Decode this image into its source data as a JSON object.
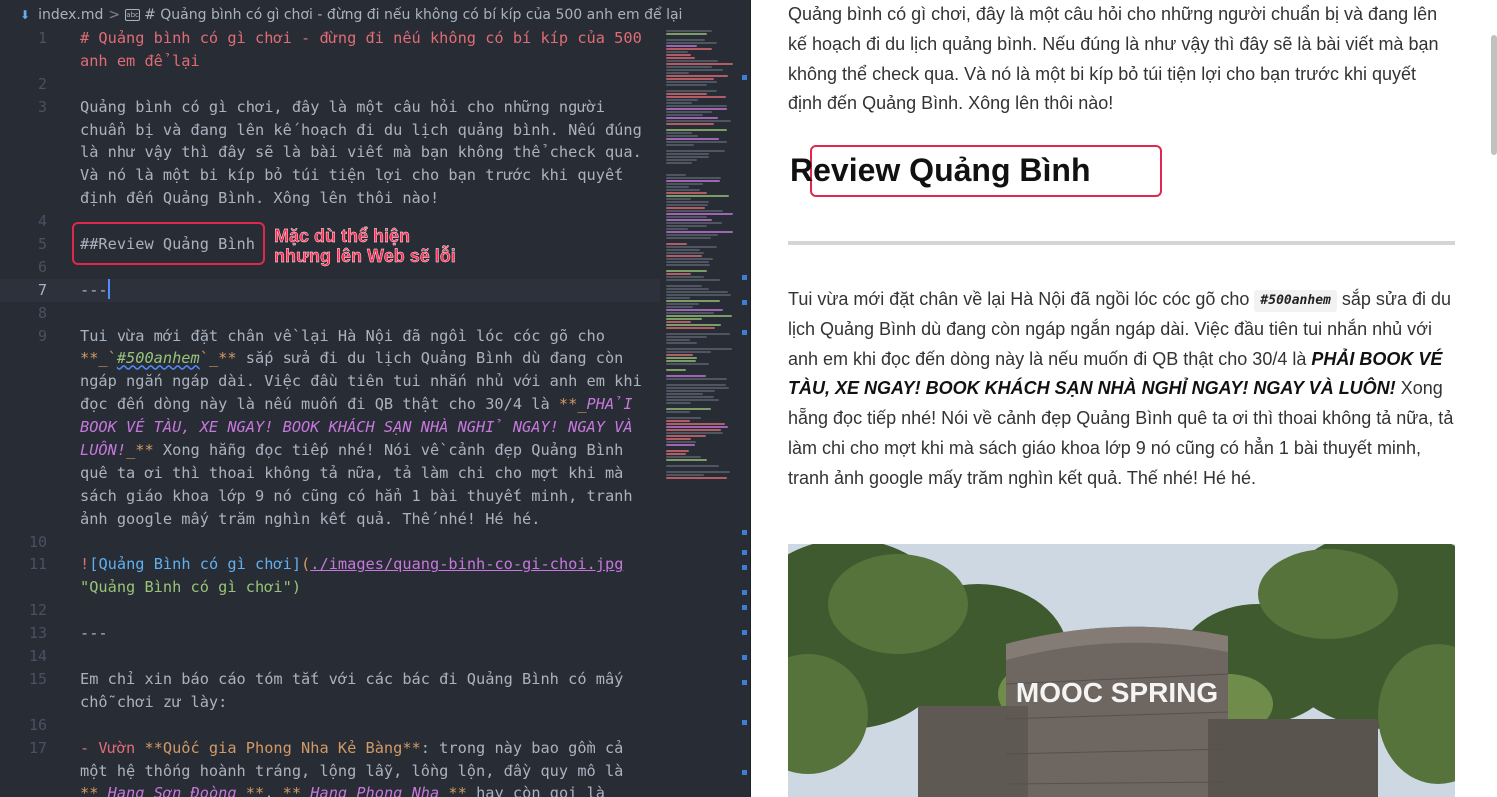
{
  "breadcrumb": {
    "file": "index.md",
    "separator": ">",
    "symbol": "# Quảng bình có gì chơi - đừng đi nếu không có bí kíp của 500 anh em để lại"
  },
  "editor": {
    "line_numbers": [
      "1",
      "",
      "2",
      "3",
      "",
      "",
      "",
      "",
      "4",
      "5",
      "6",
      "7",
      "8",
      "9",
      "",
      "",
      "",
      "",
      "",
      "",
      "",
      "",
      "10",
      "11",
      "",
      "12",
      "13",
      "14",
      "15",
      "",
      "16",
      "17",
      "",
      ""
    ],
    "line1_a": "# Quảng bình có gì chơi - đừng đi nếu không có bí kíp của 500",
    "line1_b": "anh em để lại",
    "line3": [
      "Quảng bình có gì chơi, đây là một câu hỏi cho những người",
      "chuẩn bị và đang lên kế hoạch đi du lịch quảng bình. Nếu đúng",
      "là như vậy thì đây sẽ là bài viết mà bạn không thể check qua.",
      "Và nó là một bi kíp bỏ túi tiện lợi cho bạn trước khi quyết",
      "định đến Quảng Bình. Xông lên thôi nào!"
    ],
    "line5": "##Review Quảng Bình",
    "line7": "---",
    "line9_a": "Tui vừa mới đặt chân về lại Hà Nội đã ngồi lóc cóc gõ cho",
    "line9_b_pre": "**_`",
    "line9_b_tag": "#500anhem",
    "line9_b_post": "`_**",
    "line9_b_rest": " sắp sửa đi du lịch Quảng Bình dù đang còn",
    "line9_c": "ngáp ngắn ngáp dài. Việc đầu tiên tui nhắn nhủ với anh em khi",
    "line9_d_pre": "đọc đến dòng này là nếu muốn đi QB thật cho 30/4 là ",
    "line9_d_mark": "**_",
    "line9_d_em": "PHẢI",
    "line9_e": "BOOK VÉ TÀU, XE NGAY! BOOK KHÁCH SẠN NHÀ NGHỈ NGAY! NGAY VÀ",
    "line9_f_em": "LUÔN!",
    "line9_f_mark": "_**",
    "line9_f_rest": " Xong hẵng đọc tiếp nhé! Nói về cảnh đẹp Quảng Bình",
    "line9_g": "quê ta ơi thì thoai không tả nữa, tả làm chi cho mợt khi mà",
    "line9_h": "sách giáo khoa lớp 9 nó cũng có hẳn 1 bài thuyết minh, tranh",
    "line9_i": "ảnh google mấy trăm nghìn kết quả. Thế nhé! Hé hé.",
    "line11_bang": "!",
    "line11_alt_open": "[",
    "line11_alt": "Quảng Bình có gì chơi",
    "line11_alt_close": "]",
    "line11_paren_open": "(",
    "line11_url": "./images/quang-binh-co-gi-choi.jpg",
    "line11_title": "\"Quảng Bình có gì chơi\")",
    "line13": "---",
    "line15_a": "Em chỉ xin báo cáo tóm tắt với các bác đi Quảng Bình có mấy",
    "line15_b": "chỗ chơi zư lày:",
    "line17_dash": "- Vườn ",
    "line17_bold": "**Quốc gia Phong Nha Kẻ Bàng**",
    "line17_rest": ": trong này bao gồm cả",
    "line17_b": "một hệ thống hoành tráng, lộng lẫy, lồng lộn, đầy quy mô là",
    "line17_c_m1": "** ",
    "line17_c_t1": "Hang Sơn Đoòng",
    "line17_c_m2": " **",
    "line17_c_sep": ", ",
    "line17_c_m3": "** ",
    "line17_c_t2": "Hang Phong Nha",
    "line17_c_m4": " **",
    "line17_c_rest": " hay còn gọi là"
  },
  "annotation": {
    "note_line1": "Mặc dù thể hiện",
    "note_line2": "nhưng lên Web sẽ lỗi",
    "color": "#e0284f"
  },
  "preview": {
    "intro": "Quảng bình có gì chơi, đây là một câu hỏi cho những người chuẩn bị và đang lên kế hoạch đi du lịch quảng bình. Nếu đúng là như vậy thì đây sẽ là bài viết mà bạn không thể check qua. Và nó là một bi kíp bỏ túi tiện lợi cho bạn trước khi quyết định đến Quảng Bình. Xông lên thôi nào!",
    "heading": "Review Quảng Bình",
    "body_pre": "Tui vừa mới đặt chân về lại Hà Nội đã ngồi lóc cóc gõ cho ",
    "body_tag": "#500anhem",
    "body_mid": " sắp sửa đi du lịch Quảng Bình dù đang còn ngáp ngắn ngáp dài. Việc đầu tiên tui nhắn nhủ với anh em khi đọc đến dòng này là nếu muốn đi QB thật cho 30/4 là ",
    "body_emph": "PHẢI BOOK VÉ TÀU, XE NGAY! BOOK KHÁCH SẠN NHÀ NGHỈ NGAY! NGAY VÀ LUÔN!",
    "body_post": " Xong hẵng đọc tiếp nhé! Nói về cảnh đẹp Quảng Bình quê ta ơi thì thoai không tả nữa, tả làm chi cho mợt khi mà sách giáo khoa lớp 9 nó cũng có hẳn 1 bài thuyết minh, tranh ảnh google mấy trăm nghìn kết quả. Thế nhé! Hé hé.",
    "image_sign": "MOOC SPRING"
  },
  "colors": {
    "editor_bg": "#282c34",
    "heading_red": "#e06c75",
    "accent_blue": "#528bff",
    "annotation_red": "#e0284f"
  }
}
